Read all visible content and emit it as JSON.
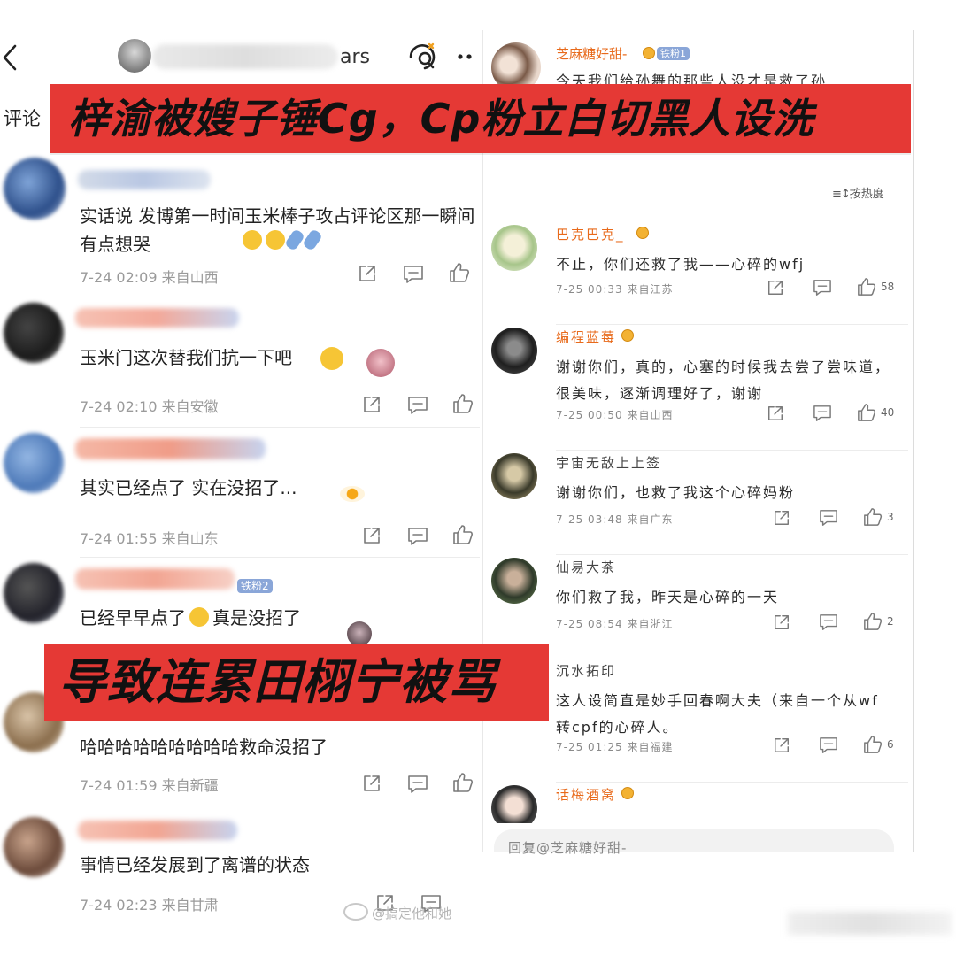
{
  "left": {
    "back_icon": "chevron-left-icon",
    "header_user_tail": "ars",
    "tab_label": "评论",
    "comments": [
      {
        "text": "实话说 发博第一时间玉米棒子攻占评论区那一瞬间有点想哭",
        "time": "7-24 02:09",
        "loc": "来自山西"
      },
      {
        "text": "玉米门这次替我们抗一下吧",
        "time": "7-24 02:10",
        "loc": "来自安徽"
      },
      {
        "text": "其实已经点了 实在没招了...",
        "time": "7-24 01:55",
        "loc": "来自山东"
      },
      {
        "text": "已经早早点了",
        "text2": "真是没招了",
        "fan_badge": "铁粉2",
        "time": "",
        "loc": ""
      },
      {
        "text": "哈哈哈哈哈哈哈哈哈救命没招了",
        "time": "7-24 01:59",
        "loc": "来自新疆"
      },
      {
        "text": "事情已经发展到了离谱的状态",
        "time": "7-24 02:23",
        "loc": "来自甘肃"
      }
    ]
  },
  "right": {
    "top": {
      "name": "芝麻糖好甜-",
      "badge": "铁粉1",
      "text": "今天我们给孙舞的那些人没才是救了孙"
    },
    "sort_label": "按热度",
    "comments": [
      {
        "name": "巴克巴克_",
        "text": "不止，你们还救了我——心碎的wfj",
        "time": "7-25 00:33",
        "loc": "来自江苏",
        "likes": "58",
        "highlight": true,
        "crown": true
      },
      {
        "name": "编程蓝莓",
        "text": "谢谢你们，真的，心塞的时候我去尝了尝味道，很美味，逐渐调理好了，谢谢",
        "time": "7-25 00:50",
        "loc": "来自山西",
        "likes": "40",
        "highlight": true,
        "crown": true
      },
      {
        "name": "宇宙无敌上上签",
        "text": "谢谢你们，也救了我这个心碎妈粉",
        "time": "7-25 03:48",
        "loc": "来自广东",
        "likes": "3",
        "highlight": false,
        "crown": false
      },
      {
        "name": "仙易大茶",
        "text": "你们救了我，昨天是心碎的一天",
        "time": "7-25 08:54",
        "loc": "来自浙江",
        "likes": "2",
        "highlight": false,
        "crown": false
      },
      {
        "name": "沉水拓印",
        "text": "这人设简直是妙手回春啊大夫（来自一个从wf转cpf的心碎人。",
        "time": "7-25 01:25",
        "loc": "来自福建",
        "likes": "6",
        "highlight": false,
        "crown": false
      },
      {
        "name": "话梅酒窝",
        "text": "",
        "time": "",
        "loc": "",
        "likes": "",
        "highlight": true,
        "crown": true
      }
    ],
    "reply_placeholder": "回复@芝麻糖好甜-"
  },
  "banners": {
    "top": "梓渝被嫂子锤Cg，Cp粉立白切黑人设洗",
    "bottom": "导致连累田栩宁被骂"
  },
  "watermark": "@搞定他和她"
}
